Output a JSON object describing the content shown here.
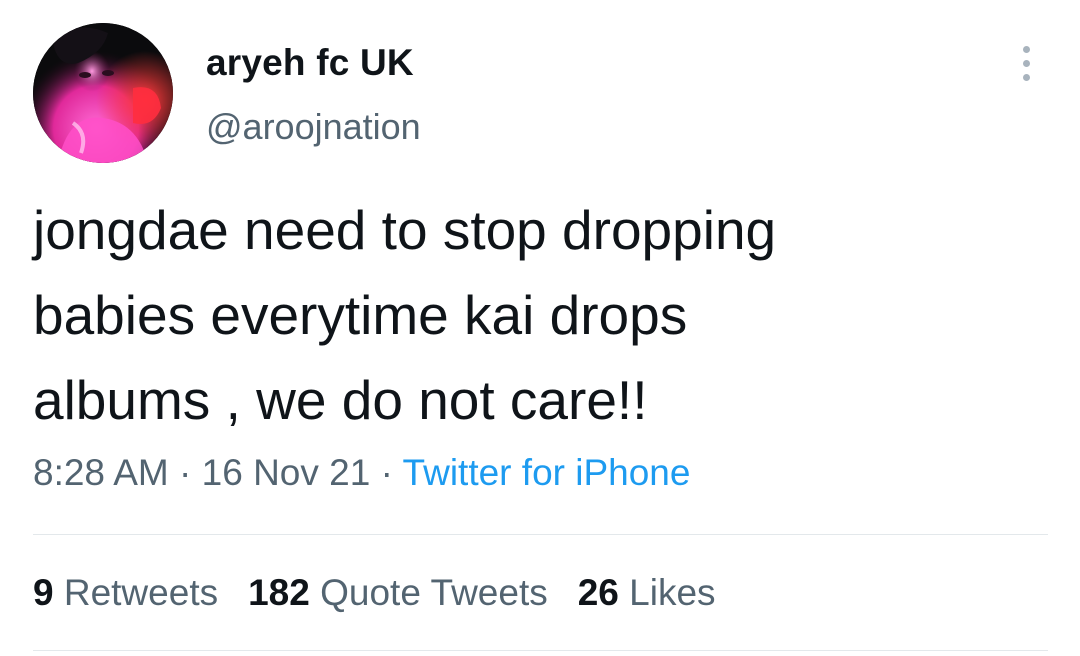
{
  "user": {
    "display_name": "aryeh fc UK",
    "handle": "@aroojnation"
  },
  "tweet": {
    "text": "jongdae need to stop dropping\nbabies everytime kai drops\nalbums , we do not care!!",
    "time": "8:28 AM",
    "separator": " · ",
    "date": "16 Nov 21",
    "source": "Twitter for iPhone"
  },
  "stats": {
    "retweets_count": "9",
    "retweets_label": "Retweets",
    "quote_tweets_count": "182",
    "quote_tweets_label": "Quote Tweets",
    "likes_count": "26",
    "likes_label": "Likes"
  },
  "icons": {
    "more": "more-options-icon"
  },
  "colors": {
    "primary_text": "#0f1419",
    "secondary_text": "#536471",
    "link": "#1d9bf0",
    "divider": "#e3e8eb"
  }
}
